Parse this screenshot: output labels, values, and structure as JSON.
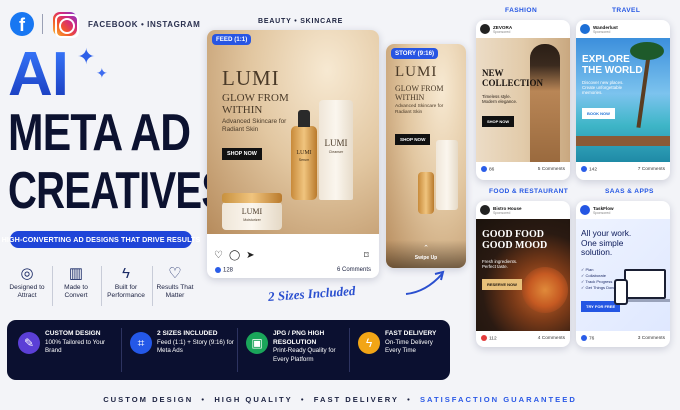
{
  "header": {
    "platforms": "FACEBOOK • INSTAGRAM"
  },
  "title": {
    "line1": "AI",
    "line2": "META AD",
    "line3": "CREATIVES"
  },
  "tagline": "HIGH-CONVERTING AD DESIGNS THAT DRIVE RESULTS",
  "features": [
    {
      "icon": "target-icon",
      "label": "Designed to Attract"
    },
    {
      "icon": "chart-icon",
      "label": "Made to Convert"
    },
    {
      "icon": "bolt-icon",
      "label": "Built for Performance"
    },
    {
      "icon": "heart-icon",
      "label": "Results That Matter"
    }
  ],
  "services": [
    {
      "icon": "pen-icon",
      "title": "CUSTOM DESIGN",
      "desc": "100% Tailored to Your Brand",
      "color": "#5b3fd6"
    },
    {
      "icon": "crop-icon",
      "title": "2 SIZES INCLUDED",
      "desc": "Feed (1:1) + Story (9:16) for Meta Ads",
      "color": "#2458e8"
    },
    {
      "icon": "image-icon",
      "title": "JPG / PNG HIGH RESOLUTION",
      "desc": "Print-Ready Quality for Every Platform",
      "color": "#1aa55a"
    },
    {
      "icon": "bolt-icon",
      "title": "FAST DELIVERY",
      "desc": "On-Time Delivery Every Time",
      "color": "#f2a516"
    }
  ],
  "footer": {
    "a": "CUSTOM DESIGN",
    "b": "HIGH QUALITY",
    "c": "FAST DELIVERY",
    "d": "SATISFACTION GUARANTEED",
    "sep": "•"
  },
  "center": {
    "category": "BEAUTY • SKINCARE",
    "feed_tag": "FEED (1:1)",
    "story_tag": "STORY (9:16)",
    "brand": "LUMI",
    "headline": "GLOW FROM WITHIN",
    "sub": "Advanced Skincare for Radiant Skin",
    "cta": "SHOP NOW",
    "likes": "128",
    "comments": "6 Comments",
    "swipe": "Swipe Up",
    "sizes_note": "2 Sizes Included",
    "product_labels": {
      "serum": "Serum",
      "cleanser": "Cleanser",
      "moisturizer": "Moisturizer"
    }
  },
  "grid": [
    {
      "category": "FASHION",
      "brand": "ZEVORA",
      "sponsored": "Sponsored",
      "headline": "NEW COLLECTION",
      "sub": "Timeless style. Modern elegance.",
      "cta": "SHOP NOW",
      "likes": "86",
      "comments": "5 Comments"
    },
    {
      "category": "TRAVEL",
      "brand": "Wanderlust",
      "sponsored": "Sponsored",
      "headline": "EXPLORE THE WORLD",
      "sub": "Discover new places. Create unforgettable memories.",
      "cta": "BOOK NOW",
      "likes": "142",
      "comments": "7 Comments"
    },
    {
      "category": "FOOD & RESTAURANT",
      "brand": "Bistro House",
      "sponsored": "Sponsored",
      "headline": "GOOD FOOD GOOD MOOD",
      "sub": "Fresh ingredients. Perfect taste.",
      "cta": "RESERVE NOW",
      "likes": "112",
      "comments": "4 Comments"
    },
    {
      "category": "SAAS & APPS",
      "brand": "TaskFlow",
      "sponsored": "Sponsored",
      "headline": "All your work. One simple solution.",
      "items": [
        "Plan",
        "Collaborate",
        "Track Progress",
        "Get Things Done"
      ],
      "cta": "TRY FOR FREE",
      "likes": "76",
      "comments": "3 Comments"
    }
  ]
}
